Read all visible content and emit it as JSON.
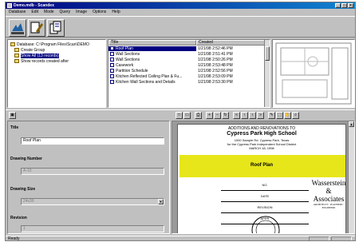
{
  "window": {
    "title": "Demo.mdb - Scandex"
  },
  "menubar": [
    "Database",
    "Edit",
    "Mode",
    "Query",
    "Image",
    "Options",
    "Help"
  ],
  "tree": [
    {
      "label": "Database: C:\\Program Files\\Scan\\DEMO"
    },
    {
      "label": "Create Group"
    },
    {
      "label": "Show All (13 records)",
      "selected": true
    },
    {
      "label": "Show records created after"
    }
  ],
  "list": {
    "columns": [
      "Title",
      "Created"
    ],
    "rows": [
      {
        "title": "Roof Plan",
        "created": "1/21/98 2:52:46 PM",
        "selected": true
      },
      {
        "title": "Wall Sections",
        "created": "1/21/98 2:51:41 PM"
      },
      {
        "title": "Wall Sections",
        "created": "1/21/98 2:50:26 PM"
      },
      {
        "title": "Casework",
        "created": "1/21/98 2:53:48 PM"
      },
      {
        "title": "Partition Schedule",
        "created": "1/21/98 2:52:56 PM"
      },
      {
        "title": "Kitchen Reflected Ceiling Plan & Fu...",
        "created": "1/21/98 2:53:09 PM"
      },
      {
        "title": "Kitchen Wall Sections and Details",
        "created": "1/21/98 2:53:30 PM"
      }
    ]
  },
  "form": {
    "title_label": "Title",
    "title_value": "Roof Plan",
    "drawing_number_label": "Drawing Number",
    "drawing_number_value": "A-10",
    "drawing_size_label": "Drawing Size",
    "drawing_size_value": "24x36",
    "revision_label": "Revision",
    "revision_value": "1"
  },
  "sheet": {
    "header_line1": "ADDITIONS AND RENOVATIONS TO",
    "header_line2": "Cypress Park High School",
    "header_line3": "1000 Sample Rd. Cypress Park, Texas",
    "header_line4": "for the Cypress Park Independent School District",
    "header_line5": "MARCH 18, 1998",
    "band_label": "Roof Plan",
    "logo_line1": "Wasserstein",
    "logo_line2": "&",
    "logo_line3": "Associates",
    "logo_small": "ARCHITECTS · PLANNERS · ENGINEERS",
    "rows": [
      "NO.",
      "DATE",
      "REVISION",
      "APPR"
    ]
  },
  "status": {
    "text": "Ready"
  },
  "colors": {
    "titlebar": "#000080",
    "band": "#e6e61a"
  }
}
